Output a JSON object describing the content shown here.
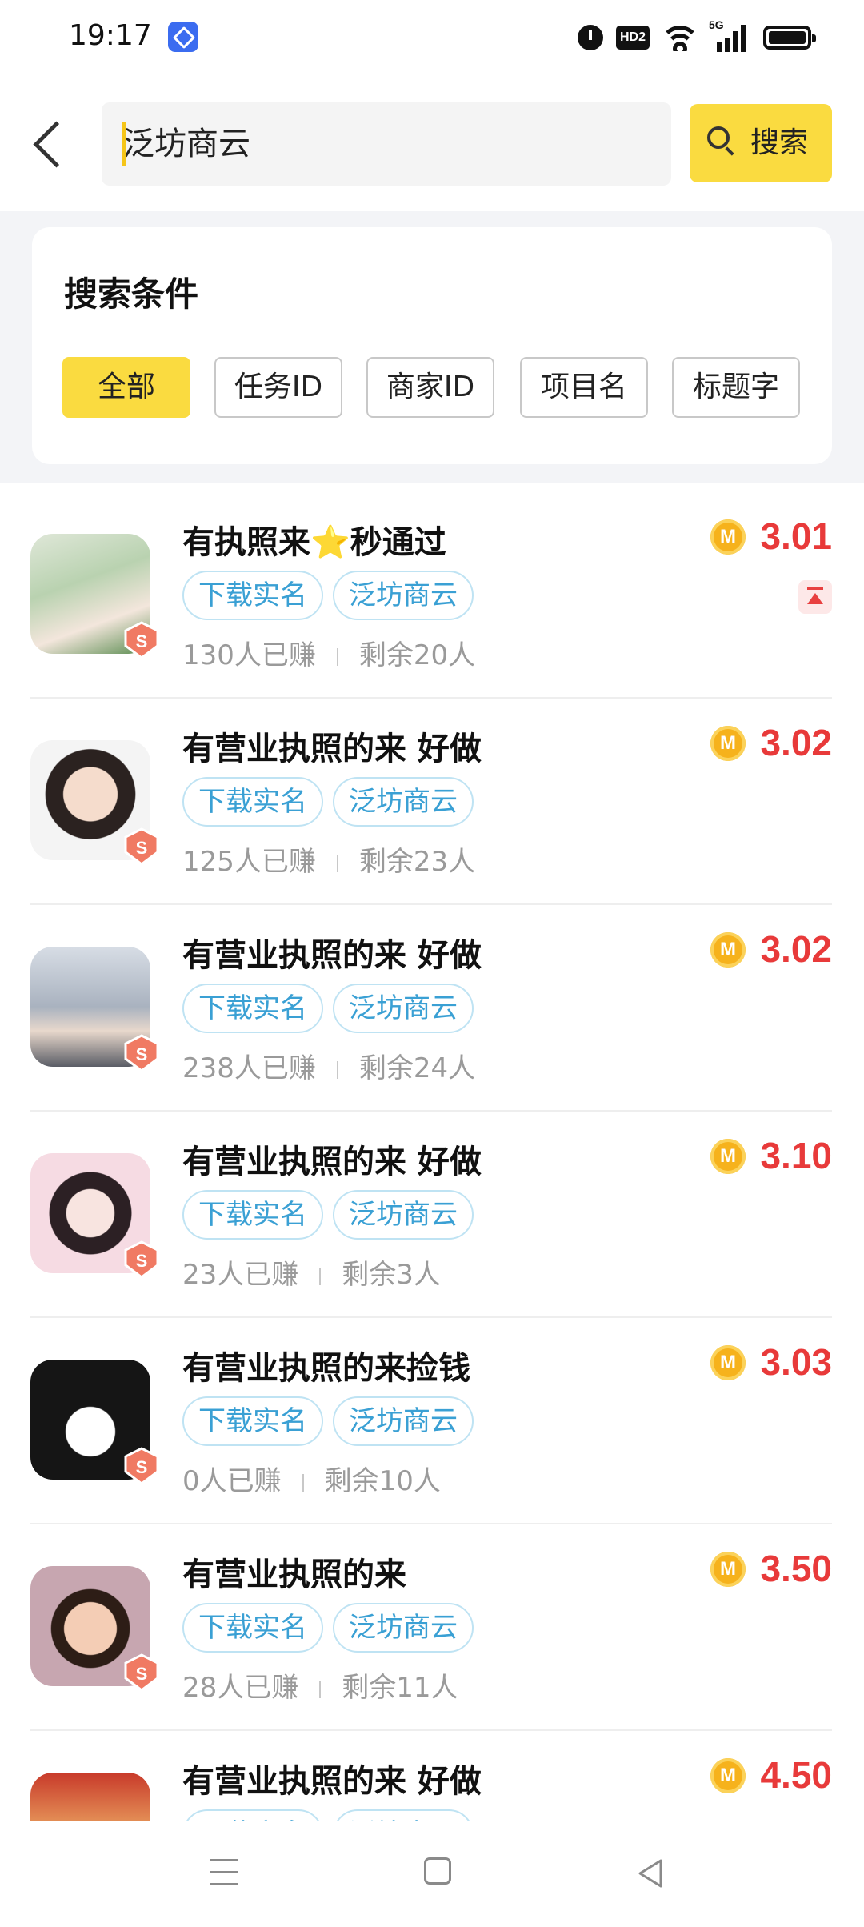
{
  "status_bar": {
    "time": "19:17",
    "hd_label": "HD2",
    "network_label": "5G"
  },
  "search": {
    "query": "泛坊商云",
    "button_label": "搜索"
  },
  "filters": {
    "title": "搜索条件",
    "options": [
      "全部",
      "任务ID",
      "商家ID",
      "项目名",
      "标题字"
    ],
    "selected": "全部"
  },
  "icons": {
    "back": "back-arrow-icon",
    "search": "search-icon",
    "coin": "coin-icon",
    "pin_top": "pin-to-top-icon",
    "verified": "verified-shield-icon"
  },
  "colors": {
    "accent": "#fadb40",
    "price": "#e83a3a",
    "tag": "#3aa0d4"
  },
  "tasks": [
    {
      "title": "有执照来⭐秒通过",
      "tags": [
        "下载实名",
        "泛坊商云"
      ],
      "earned": "130人已赚",
      "remaining": "剩余20人",
      "coin_label": "M",
      "price": "3.01",
      "pinned": true
    },
    {
      "title": "有营业执照的来  好做",
      "tags": [
        "下载实名",
        "泛坊商云"
      ],
      "earned": "125人已赚",
      "remaining": "剩余23人",
      "coin_label": "M",
      "price": "3.02",
      "pinned": false
    },
    {
      "title": "有营业执照的来  好做",
      "tags": [
        "下载实名",
        "泛坊商云"
      ],
      "earned": "238人已赚",
      "remaining": "剩余24人",
      "coin_label": "M",
      "price": "3.02",
      "pinned": false
    },
    {
      "title": "有营业执照的来  好做",
      "tags": [
        "下载实名",
        "泛坊商云"
      ],
      "earned": "23人已赚",
      "remaining": "剩余3人",
      "coin_label": "M",
      "price": "3.10",
      "pinned": false
    },
    {
      "title": "有营业执照的来捡钱",
      "tags": [
        "下载实名",
        "泛坊商云"
      ],
      "earned": "0人已赚",
      "remaining": "剩余10人",
      "coin_label": "M",
      "price": "3.03",
      "pinned": false
    },
    {
      "title": "有营业执照的来",
      "tags": [
        "下载实名",
        "泛坊商云"
      ],
      "earned": "28人已赚",
      "remaining": "剩余11人",
      "coin_label": "M",
      "price": "3.50",
      "pinned": false
    },
    {
      "title": "有营业执照的来  好做",
      "tags": [
        "下载实名",
        "泛坊商云"
      ],
      "earned": "",
      "remaining": "",
      "coin_label": "M",
      "price": "4.50",
      "pinned": false
    }
  ]
}
